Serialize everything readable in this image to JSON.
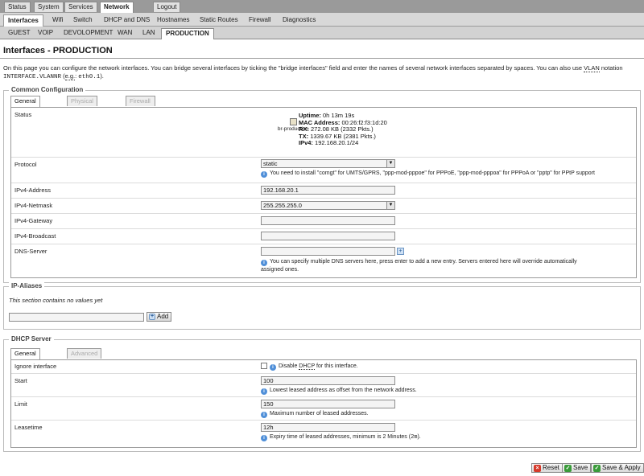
{
  "menu_main": {
    "items": [
      "Status",
      "System",
      "Services",
      "Network",
      "Logout"
    ],
    "active": "Network"
  },
  "menu_network": {
    "items": [
      "Interfaces",
      "Wifi",
      "Switch",
      "DHCP and DNS",
      "Hostnames",
      "Static Routes",
      "Firewall",
      "Diagnostics"
    ],
    "active": "Interfaces"
  },
  "menu_interfaces": {
    "items": [
      "GUEST",
      "VOIP",
      "DEVOLOPMENT",
      "WAN",
      "LAN",
      "PRODUCTION"
    ],
    "active": "PRODUCTION"
  },
  "page": {
    "title": "Interfaces - PRODUCTION",
    "description_1": "On this page you can configure the network interfaces. You can bridge several interfaces by ticking the \"bridge interfaces\" field and enter the names of several network interfaces separated by spaces. You can also use ",
    "vlan_abbr": "VLAN",
    "description_2": " notation ",
    "notation_code": "INTERFACE.VLANNR",
    "description_3": " (",
    "eg_abbr": "e.g.",
    "description_4": ": ",
    "example_code": "eth0.1",
    "description_5": ")."
  },
  "common_config": {
    "legend": "Common Configuration",
    "tabs": [
      "General Setup",
      "Physical Settings",
      "Firewall Settings"
    ],
    "status": {
      "label": "Status",
      "device_name": "br-production",
      "uptime_label": "Uptime:",
      "uptime_value": "0h 13m 19s",
      "mac_label": "MAC Address:",
      "mac_value": "00:26:f2:f3:1d:20",
      "rx_label": "RX:",
      "rx_value": "272.08 KB (2332 Pkts.)",
      "tx_label": "TX:",
      "tx_value": "1339.67 KB (2381 Pkts.)",
      "ipv4_label": "IPv4:",
      "ipv4_value": "192.168.20.1/24"
    },
    "protocol": {
      "label": "Protocol",
      "value": "static",
      "hint": "You need to install \"comgt\" for UMTS/GPRS, \"ppp-mod-pppoe\" for PPPoE, \"ppp-mod-pppoa\" for PPPoA or \"pptp\" for PPtP support"
    },
    "ipv4_address": {
      "label": "IPv4-Address",
      "value": "192.168.20.1"
    },
    "ipv4_netmask": {
      "label": "IPv4-Netmask",
      "value": "255.255.255.0"
    },
    "ipv4_gateway": {
      "label": "IPv4-Gateway",
      "value": ""
    },
    "ipv4_broadcast": {
      "label": "IPv4-Broadcast",
      "value": ""
    },
    "dns_server": {
      "label": "DNS-Server",
      "value": "",
      "hint_line1": "You can specify multiple DNS servers here, press enter to add a new entry. Servers entered here will override automatically",
      "hint_line2": "assigned ones."
    }
  },
  "ip_aliases": {
    "legend": "IP-Aliases",
    "empty_text": "This section contains no values yet",
    "add_label": "Add",
    "input_value": ""
  },
  "dhcp_server": {
    "legend": "DHCP Server",
    "tabs": [
      "General Setup",
      "Advanced Settings"
    ],
    "ignore": {
      "label": "Ignore interface",
      "checked": false,
      "hint_pre": "Disable ",
      "dhcp_abbr": "DHCP",
      "hint_post": " for this interface."
    },
    "start": {
      "label": "Start",
      "value": "100",
      "hint": "Lowest leased address as offset from the network address."
    },
    "limit": {
      "label": "Limit",
      "value": "150",
      "hint": "Maximum number of leased addresses."
    },
    "leasetime": {
      "label": "Leasetime",
      "value": "12h",
      "hint_pre": "Expiry time of leased addresses, minimum is 2 Minutes (",
      "hint_code": "2m",
      "hint_post": ")."
    }
  },
  "actions": {
    "reset_label": "Reset",
    "save_label": "Save",
    "save_apply_label": "Save & Apply"
  },
  "colors": {
    "reset_icon": "#d63a2b",
    "save_icon": "#3a9b3a",
    "info_icon": "#4f8fd8"
  }
}
